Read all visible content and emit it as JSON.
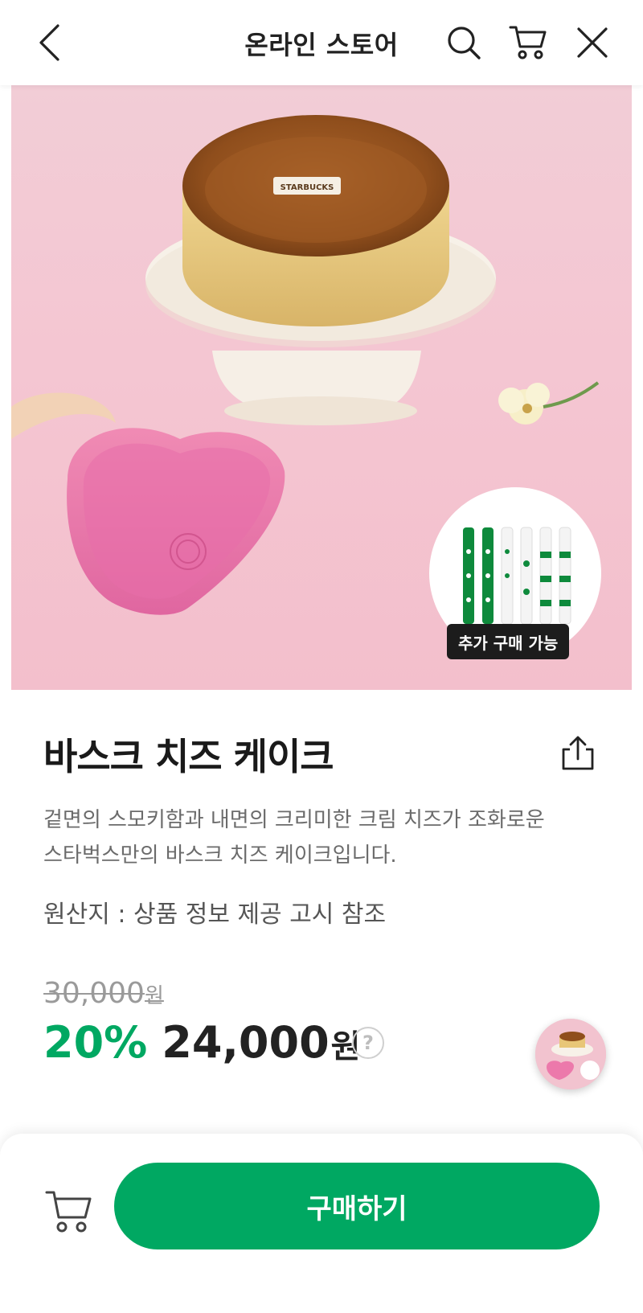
{
  "header": {
    "title": "온라인 스토어"
  },
  "product": {
    "name": "바스크 치즈 케이크",
    "description_line1": "겉면의 스모키함과 내면의 크리미한 크림 치즈가 조화로운",
    "description_line2": "스타벅스만의 바스크 치즈 케이크입니다.",
    "origin": "원산지 : 상품 정보 제공 고시 참조",
    "original_price": "30,000",
    "original_price_unit": "원",
    "discount": "20%",
    "sale_price": "24,000",
    "sale_price_unit": "원",
    "help_mark": "?",
    "image_badge": "추가 구매 가능",
    "logo_text": "STARBUCKS"
  },
  "bottom": {
    "buy_label": "구매하기"
  },
  "colors": {
    "accent": "#00a862",
    "text": "#222222",
    "muted": "#6b6b6b"
  }
}
